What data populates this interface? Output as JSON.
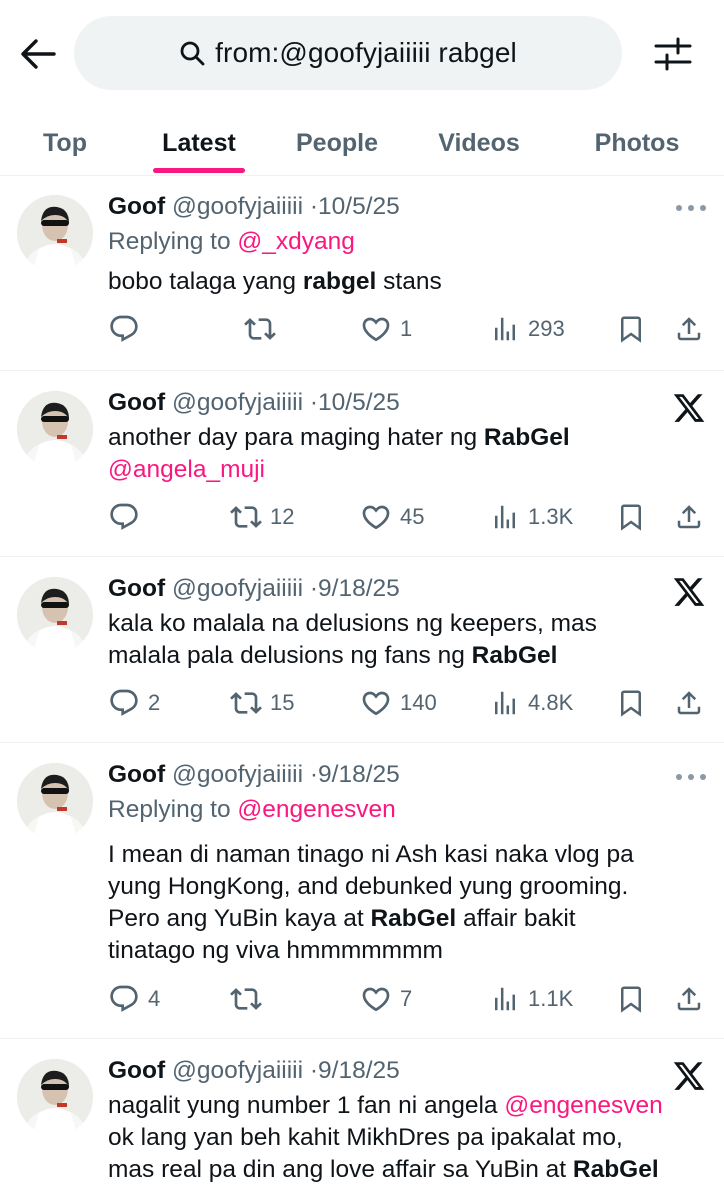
{
  "search": {
    "query": "from:@goofyjaiiiii rabgel"
  },
  "tabs": [
    {
      "label": "Top"
    },
    {
      "label": "Latest"
    },
    {
      "label": "People"
    },
    {
      "label": "Videos"
    },
    {
      "label": "Photos"
    }
  ],
  "active_tab": "Latest",
  "accent_color": "#f91880",
  "tweets": [
    {
      "name": "Goof",
      "handle": "@goofyjaiiiii",
      "dot": "·",
      "date": "10/5/25",
      "reply_prefix": "Replying to ",
      "reply_to": "@_xdyang",
      "text_parts": [
        "bobo talaga yang ",
        "rabgel",
        " stans"
      ],
      "corner_icon": "more-icon",
      "replies": "",
      "retweets": "",
      "likes": "1",
      "views": "293"
    },
    {
      "name": "Goof",
      "handle": "@goofyjaiiiii",
      "dot": "·",
      "date": "10/5/25",
      "text_parts": [
        "another day para maging hater ng ",
        "RabGel",
        "@angela_muji"
      ],
      "corner_icon": "x-logo-icon",
      "replies": "",
      "retweets": "12",
      "likes": "45",
      "views": "1.3K"
    },
    {
      "name": "Goof",
      "handle": "@goofyjaiiiii",
      "dot": "·",
      "date": "9/18/25",
      "text_parts": [
        "kala ko malala na delusions ng keepers, mas",
        "malala pala delusions ng fans ng ",
        "RabGel"
      ],
      "corner_icon": "x-logo-icon",
      "replies": "2",
      "retweets": "15",
      "likes": "140",
      "views": "4.8K"
    },
    {
      "name": "Goof",
      "handle": "@goofyjaiiiii",
      "dot": "·",
      "date": "9/18/25",
      "reply_prefix": "Replying to ",
      "reply_to": "@engenesven",
      "text_parts": [
        "I mean di naman tinago ni Ash kasi naka vlog pa",
        "yung HongKong, and debunked yung grooming.",
        "Pero ang YuBin kaya at ",
        "RabGel",
        " affair bakit",
        "tinatago ng viva hmmmmmmm"
      ],
      "corner_icon": "more-icon",
      "replies": "4",
      "retweets": "",
      "likes": "7",
      "views": "1.1K"
    },
    {
      "name": "Goof",
      "handle": "@goofyjaiiiii",
      "dot": "·",
      "date": "9/18/25",
      "text_parts": [
        "nagalit yung number 1 fan ni angela ",
        "@engenesven",
        "ok lang yan beh kahit MikhDres pa ipakalat mo,",
        "mas real pa din ang love affair sa YuBin at ",
        "RabGel"
      ],
      "corner_icon": "x-logo-icon"
    }
  ]
}
